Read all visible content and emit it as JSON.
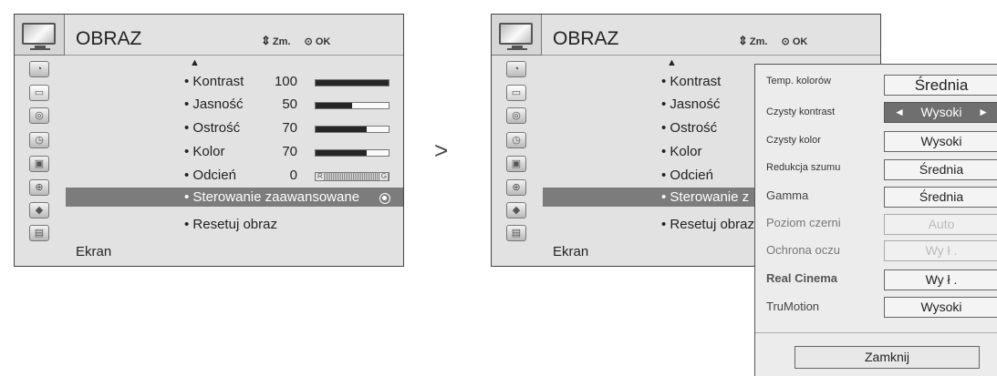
{
  "menu_title": "OBRAZ",
  "hint_move_icon": "four-way-arrow",
  "hint_move": "Zm.",
  "hint_ok_icon": "circle-dot",
  "hint_ok": "OK",
  "scroll_up_icon": "triangle-up",
  "footer_label": "Ekran",
  "left_items": [
    {
      "label": "• Kontrast",
      "value": "100",
      "level": 1.0
    },
    {
      "label": "• Jasność",
      "value": "50",
      "level": 0.5
    },
    {
      "label": "• Ostrość",
      "value": "70",
      "level": 0.7
    },
    {
      "label": "• Kolor",
      "value": "70",
      "level": 0.7
    },
    {
      "label": "• Odcień",
      "value": "0",
      "tint_left": "R",
      "tint_right": "G"
    },
    {
      "label": "• Sterowanie zaawansowane",
      "selected": true
    },
    {
      "label": "• Resetuj obraz"
    }
  ],
  "right_items": [
    "• Kontrast",
    "• Jasność",
    "• Ostrość",
    "• Kolor",
    "• Odcień",
    "• Sterowanie z",
    "• Resetuj obraz"
  ],
  "sidebar_icons": [
    "satellite-dish-icon",
    "tv-picture-icon",
    "speaker-icon",
    "clock-icon",
    "lock-icon",
    "option-icon",
    "input-icon",
    "media-icon"
  ],
  "separator_symbol": ">",
  "advanced": {
    "rows": [
      {
        "label": "Temp. kolorów",
        "value": "Średnia"
      },
      {
        "label": "Czysty kontrast",
        "value": "Wysoki",
        "selected": true,
        "left_arrow": "◄",
        "right_arrow": "►"
      },
      {
        "label": "Czysty kolor",
        "value": "Wysoki"
      },
      {
        "label": "Redukcja szumu",
        "value": "Średnia"
      },
      {
        "label": "Gamma",
        "value": "Średnia"
      },
      {
        "label": "Poziom czerni",
        "value": "Auto",
        "disabled": true
      },
      {
        "label": "Ochrona oczu",
        "value": "Wy ł .",
        "disabled": true
      },
      {
        "label": "Real Cinema",
        "value": "Wy ł ."
      },
      {
        "label": "TruMotion",
        "value": "Wysoki"
      }
    ],
    "close_label": "Zamknij"
  }
}
